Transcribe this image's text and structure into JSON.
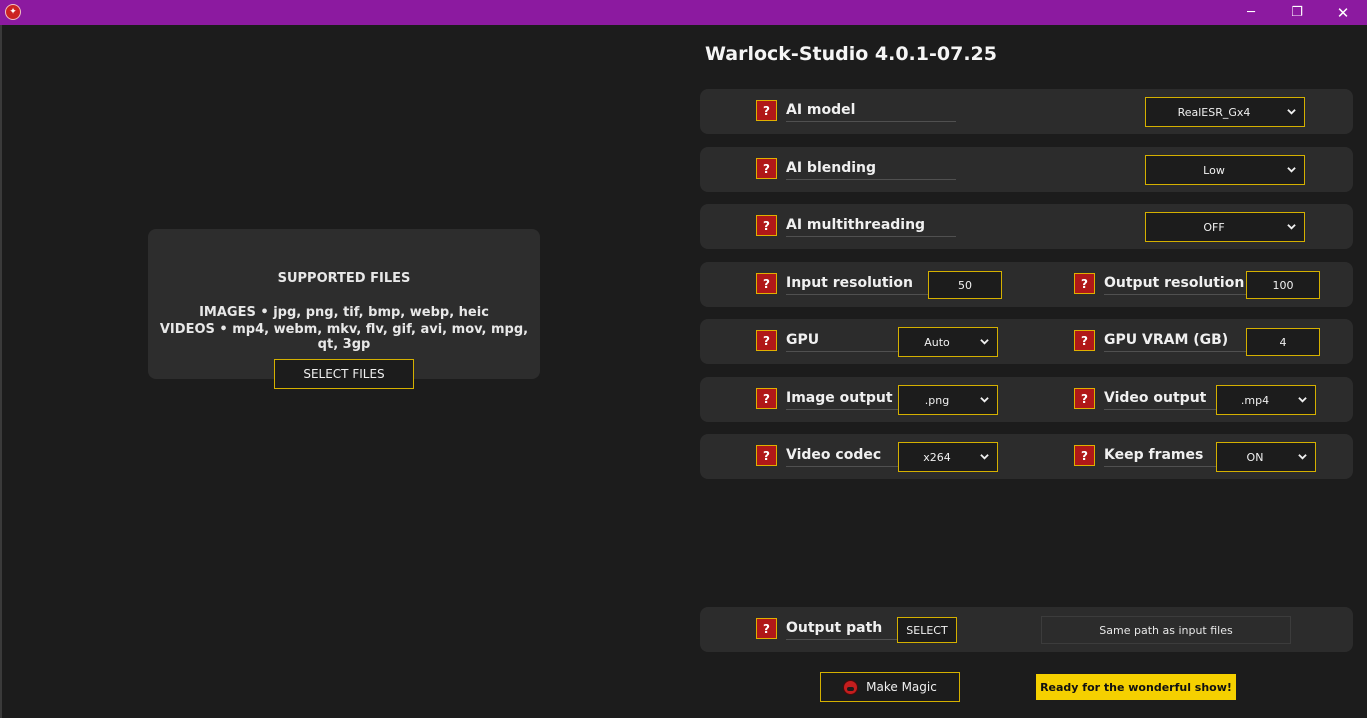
{
  "window": {
    "minimize": "─",
    "maximize": "❐",
    "close": "✕",
    "accent_color": "#8c1aa0"
  },
  "drop_area": {
    "title": "SUPPORTED FILES",
    "images_line": "IMAGES • jpg, png, tif, bmp, webp, heic",
    "videos_line": "VIDEOS • mp4, webm, mkv, flv, gif, avi, mov, mpg, qt, 3gp",
    "select_button": "SELECT FILES"
  },
  "header": {
    "title": "Warlock-Studio 4.0.1-07.25"
  },
  "help_mark": "?",
  "options": {
    "ai_model": {
      "label": "AI model",
      "value": "RealESR_Gx4"
    },
    "ai_blending": {
      "label": "AI blending",
      "value": "Low"
    },
    "ai_multithreading": {
      "label": "AI multithreading",
      "value": "OFF"
    },
    "input_resolution": {
      "label": "Input resolution",
      "value": "50"
    },
    "output_resolution": {
      "label": "Output resolution",
      "value": "100"
    },
    "gpu": {
      "label": "GPU",
      "value": "Auto"
    },
    "gpu_vram": {
      "label": "GPU VRAM (GB)",
      "value": "4"
    },
    "image_output": {
      "label": "Image output",
      "value": ".png"
    },
    "video_output": {
      "label": "Video output",
      "value": ".mp4"
    },
    "video_codec": {
      "label": "Video codec",
      "value": "x264"
    },
    "keep_frames": {
      "label": "Keep frames",
      "value": "ON"
    },
    "output_path": {
      "label": "Output path",
      "button": "SELECT",
      "value": "Same path as input files"
    }
  },
  "footer": {
    "make_magic": "Make Magic",
    "status": "Ready for the wonderful show!",
    "status_color": "#f5d000",
    "border_color": "#d4b000",
    "help_color": "#b01818"
  }
}
